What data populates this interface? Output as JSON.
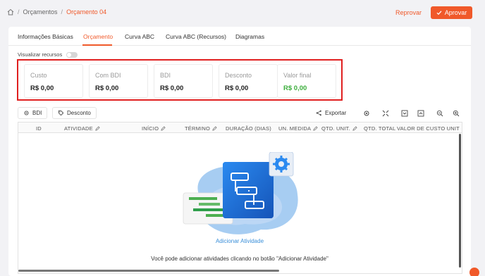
{
  "breadcrumb": {
    "items": [
      "Orçamentos",
      "Orçamento 04"
    ],
    "separator": "/"
  },
  "actions": {
    "reprovar": "Reprovar",
    "aprovar": "Aprovar"
  },
  "tabs": [
    {
      "label": "Informações Básicas"
    },
    {
      "label": "Orçamento"
    },
    {
      "label": "Curva ABC"
    },
    {
      "label": "Curva ABC (Recursos)"
    },
    {
      "label": "Diagramas"
    }
  ],
  "toggle": {
    "label": "Visualizar recursos",
    "on": false
  },
  "summary": [
    {
      "label": "Custo",
      "value": "R$ 0,00"
    },
    {
      "label": "Com BDI",
      "value": "R$ 0,00"
    },
    {
      "label": "BDI",
      "value": "R$ 0,00"
    },
    {
      "label": "Desconto",
      "value": "R$ 0,00"
    },
    {
      "label": "Valor final",
      "value": "R$ 0,00"
    }
  ],
  "toolbar": {
    "bdi": "BDI",
    "desconto": "Desconto",
    "exportar": "Exportar"
  },
  "columns": [
    "ID",
    "ATIVIDADE",
    "INÍCIO",
    "TÉRMINO",
    "DURAÇÃO (DIAS)",
    "UN. MEDIDA",
    "QTD. UNIT.",
    "QTD. TOTAL",
    "VALOR DE CUSTO UNIT"
  ],
  "empty_state": {
    "link": "Adicionar Atividade",
    "hint": "Você pode adicionar atividades clicando no botão \"Adicionar Atividade\""
  },
  "colors": {
    "accent": "#f0592a",
    "positive": "#3cae3c",
    "link": "#3a8fd9",
    "highlight": "#e02020"
  },
  "icons": [
    "home-icon",
    "check-icon",
    "gear-icon",
    "tag-icon",
    "share-icon",
    "expand-icon",
    "collapse-icon",
    "zoom-out-icon",
    "zoom-in-icon",
    "pencil-icon"
  ]
}
